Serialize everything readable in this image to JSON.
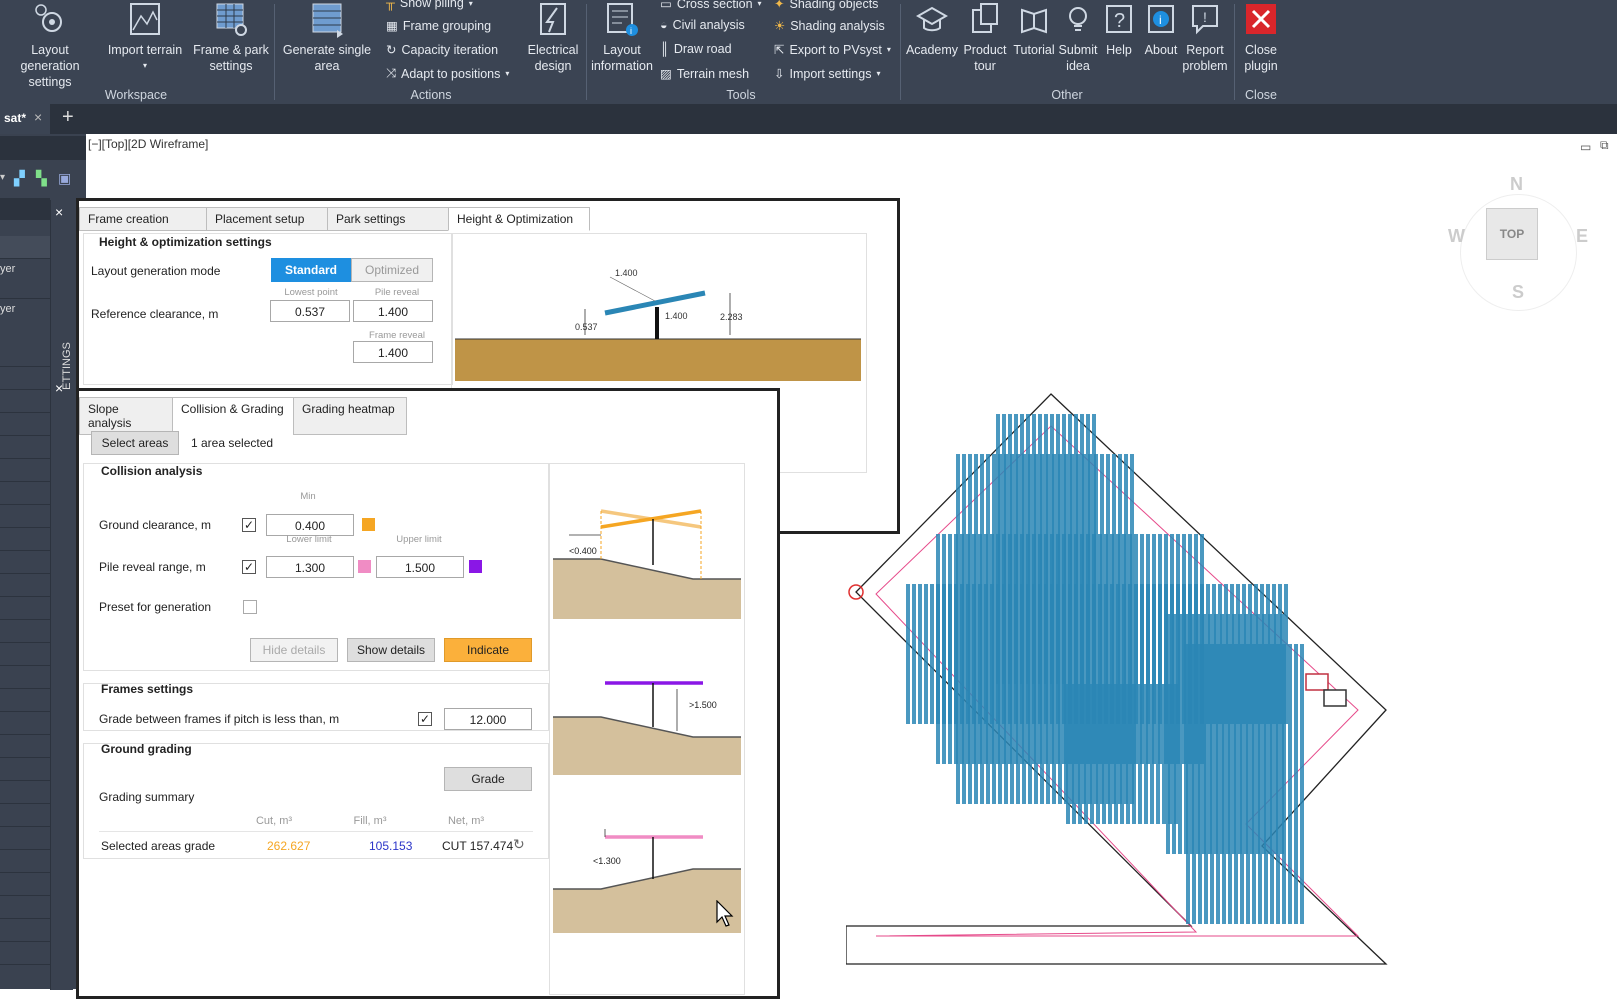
{
  "ribbon": {
    "workspace": {
      "label": "Workspace",
      "layout_generation": "Layout generation settings",
      "import_terrain": "Import terrain",
      "frame_park": "Frame & park settings"
    },
    "actions": {
      "label": "Actions",
      "generate_single": "Generate single area",
      "show_piling": "Show piling",
      "frame_grouping": "Frame grouping",
      "capacity_iteration": "Capacity iteration",
      "adapt_positions": "Adapt to positions",
      "electrical_design": "Electrical design"
    },
    "tools": {
      "label": "Tools",
      "layout_information": "Layout information",
      "cross_section": "Cross section",
      "civil_analysis": "Civil analysis",
      "draw_road": "Draw road",
      "terrain_mesh": "Terrain mesh",
      "shading_objects": "Shading objects",
      "shading_analysis": "Shading analysis",
      "export_pvsyst": "Export to PVsyst",
      "import_settings": "Import settings"
    },
    "other": {
      "label": "Other",
      "academy": "Academy",
      "product_tour": "Product tour",
      "tutorial": "Tutorial",
      "submit_idea": "Submit idea",
      "help": "Help",
      "about": "About",
      "report_problem": "Report problem"
    },
    "close": {
      "label": "Close",
      "close_plugin": "Close plugin"
    }
  },
  "doc_tab": {
    "name": "sat*"
  },
  "viewport": {
    "label": "[−][Top][2D Wireframe]"
  },
  "left_panel": {
    "row_labels": [
      "yer",
      "yer"
    ],
    "settings_vertical": "ETTINGS"
  },
  "viewcube": {
    "n": "N",
    "s": "S",
    "w": "W",
    "e": "E",
    "top": "TOP"
  },
  "height_panel": {
    "tabs": [
      "Frame creation",
      "Placement setup",
      "Park settings",
      "Height & Optimization"
    ],
    "section_title": "Height & optimization settings",
    "mode_label": "Layout generation mode",
    "mode_standard": "Standard",
    "mode_optimized": "Optimized",
    "clearance_label": "Reference clearance, m",
    "lowest_point_label": "Lowest point",
    "pile_reveal_label": "Pile reveal",
    "frame_reveal_label": "Frame reveal",
    "lowest_point": "0.537",
    "pile_reveal": "1.400",
    "frame_reveal": "1.400",
    "diagram": {
      "top": "1.400",
      "low": "0.537",
      "pile": "1.400",
      "high": "2.283"
    }
  },
  "grading_panel": {
    "tabs": [
      "Slope analysis",
      "Collision & Grading",
      "Grading heatmap"
    ],
    "select_areas": "Select areas",
    "areas_selected": "1 area selected",
    "collision_title": "Collision analysis",
    "ground_clearance_label": "Ground clearance, m",
    "min_label": "Min",
    "ground_clearance": "0.400",
    "pile_range_label": "Pile reveal range, m",
    "lower_limit_label": "Lower limit",
    "upper_limit_label": "Upper limit",
    "lower_limit": "1.300",
    "upper_limit": "1.500",
    "preset_label": "Preset for generation",
    "hide_details": "Hide details",
    "show_details": "Show details",
    "indicate": "Indicate",
    "frames_title": "Frames settings",
    "grade_between_label": "Grade between frames if pitch is less than, m",
    "grade_between": "12.000",
    "ground_title": "Ground grading",
    "grade_btn": "Grade",
    "summary_label": "Grading summary",
    "col_cut": "Cut, m³",
    "col_fill": "Fill, m³",
    "col_net": "Net, m³",
    "row_label": "Selected areas grade",
    "cut": "262.627",
    "fill": "105.153",
    "net": "CUT 157.474",
    "diag1_label": "<0.400",
    "diag2_label": ">1.500",
    "diag3_label": "<1.300"
  },
  "colors": {
    "ribbon_bg": "#3b4453",
    "accent_blue": "#1e8fe0",
    "orange": "#f5a623",
    "pink": "#f08cc4",
    "purple": "#8a17e6",
    "panel_blue": "#2a86b5",
    "close_red": "#d9262b"
  }
}
